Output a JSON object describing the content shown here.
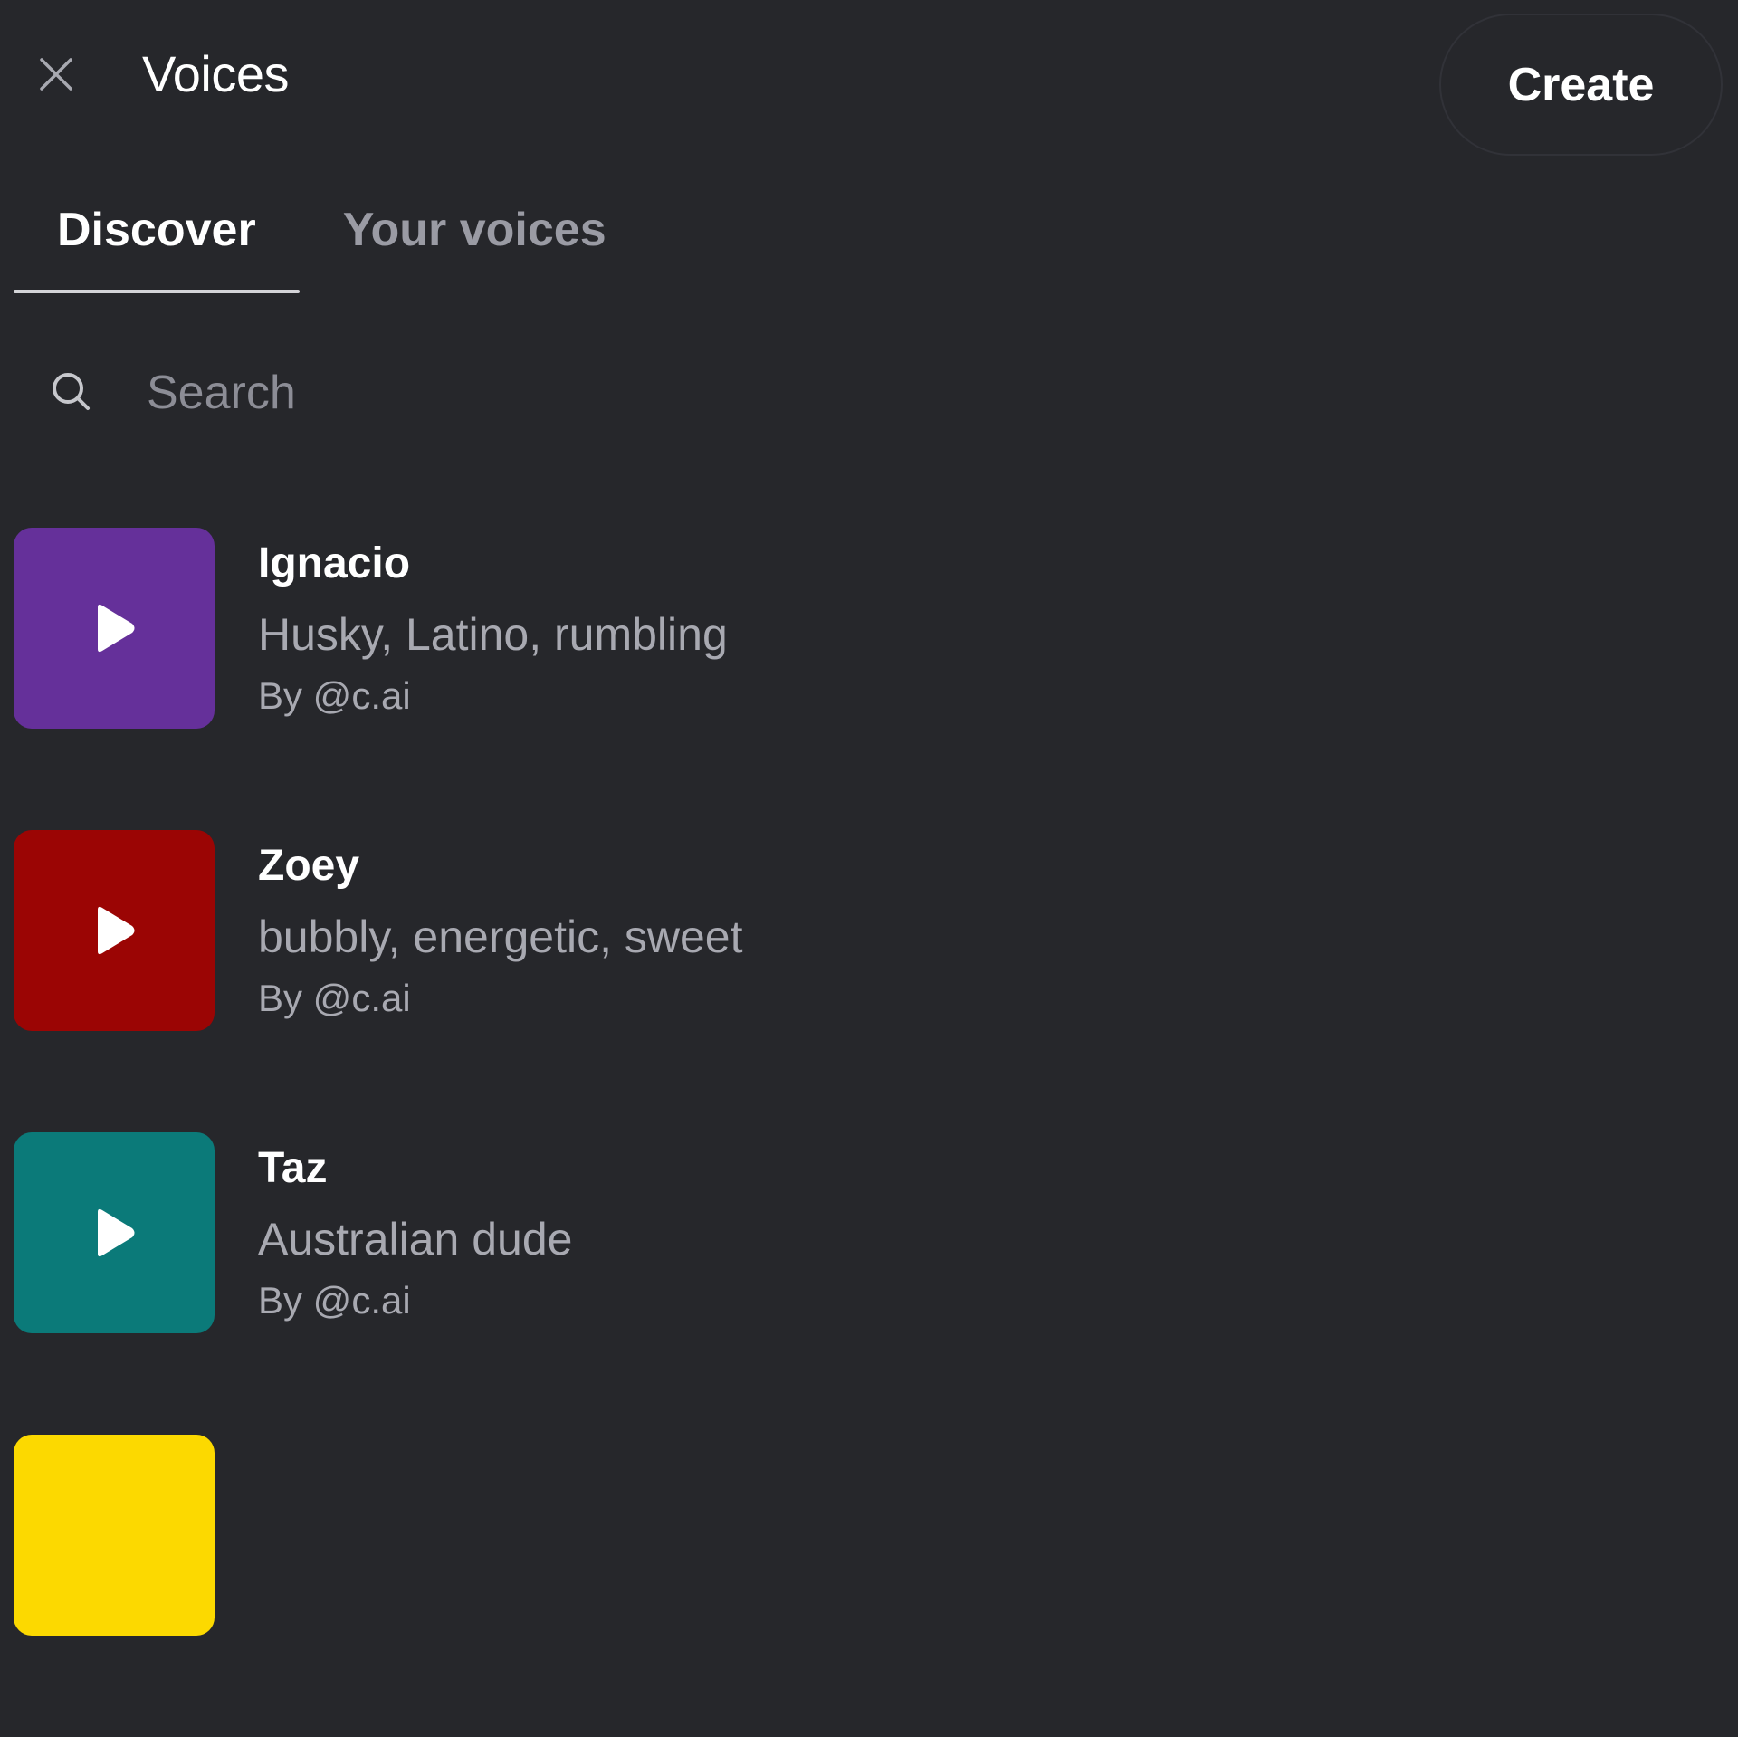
{
  "header": {
    "title": "Voices",
    "close_icon": "close-icon",
    "create_label": "Create"
  },
  "tabs": [
    {
      "label": "Discover",
      "active": true
    },
    {
      "label": "Your voices",
      "active": false
    }
  ],
  "search": {
    "placeholder": "Search",
    "value": "",
    "icon": "search-icon"
  },
  "voices": [
    {
      "name": "Ignacio",
      "description": "Husky, Latino, rumbling",
      "author": "By @c.ai",
      "color": "#65309a",
      "icon": "play-icon"
    },
    {
      "name": "Zoey",
      "description": "bubbly, energetic, sweet",
      "author": "By @c.ai",
      "color": "#9b0504",
      "icon": "play-icon"
    },
    {
      "name": "Taz",
      "description": "Australian dude",
      "author": "By @c.ai",
      "color": "#0b7a79",
      "icon": "play-icon"
    },
    {
      "name": "",
      "description": "",
      "author": "",
      "color": "#fcd900",
      "icon": "play-icon"
    }
  ],
  "colors": {
    "background": "#26272b",
    "text_primary": "#ffffff",
    "text_secondary": "#a8a9b1",
    "tab_underline": "#d4d4d8"
  }
}
